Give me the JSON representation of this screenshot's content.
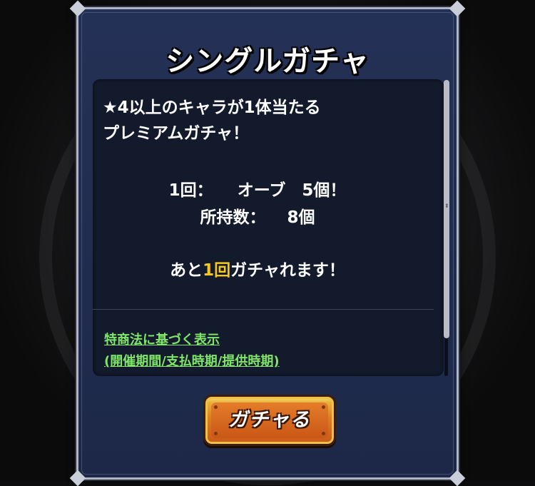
{
  "dialog": {
    "title": "シングルガチャ",
    "intro_line1": "★4以上のキャラが1体当たる",
    "intro_line2": "プレミアムガチャ！",
    "cost_label": "1回：",
    "cost_value": "オーブ　5個！",
    "owned_label": "所持数：",
    "owned_value": "8個",
    "remain_prefix": "あと",
    "remain_count": "1回",
    "remain_suffix": "ガチャれます！",
    "link_legal": "特商法に基づく表示",
    "link_periods": "(開催期間/支払時期/提供時期)",
    "button_label": "ガチャる"
  },
  "colors": {
    "panel": "#202c4e",
    "content_bg": "#121a2c",
    "highlight": "#f7c81a",
    "link": "#7fe66a",
    "button": "#dc7d23"
  }
}
